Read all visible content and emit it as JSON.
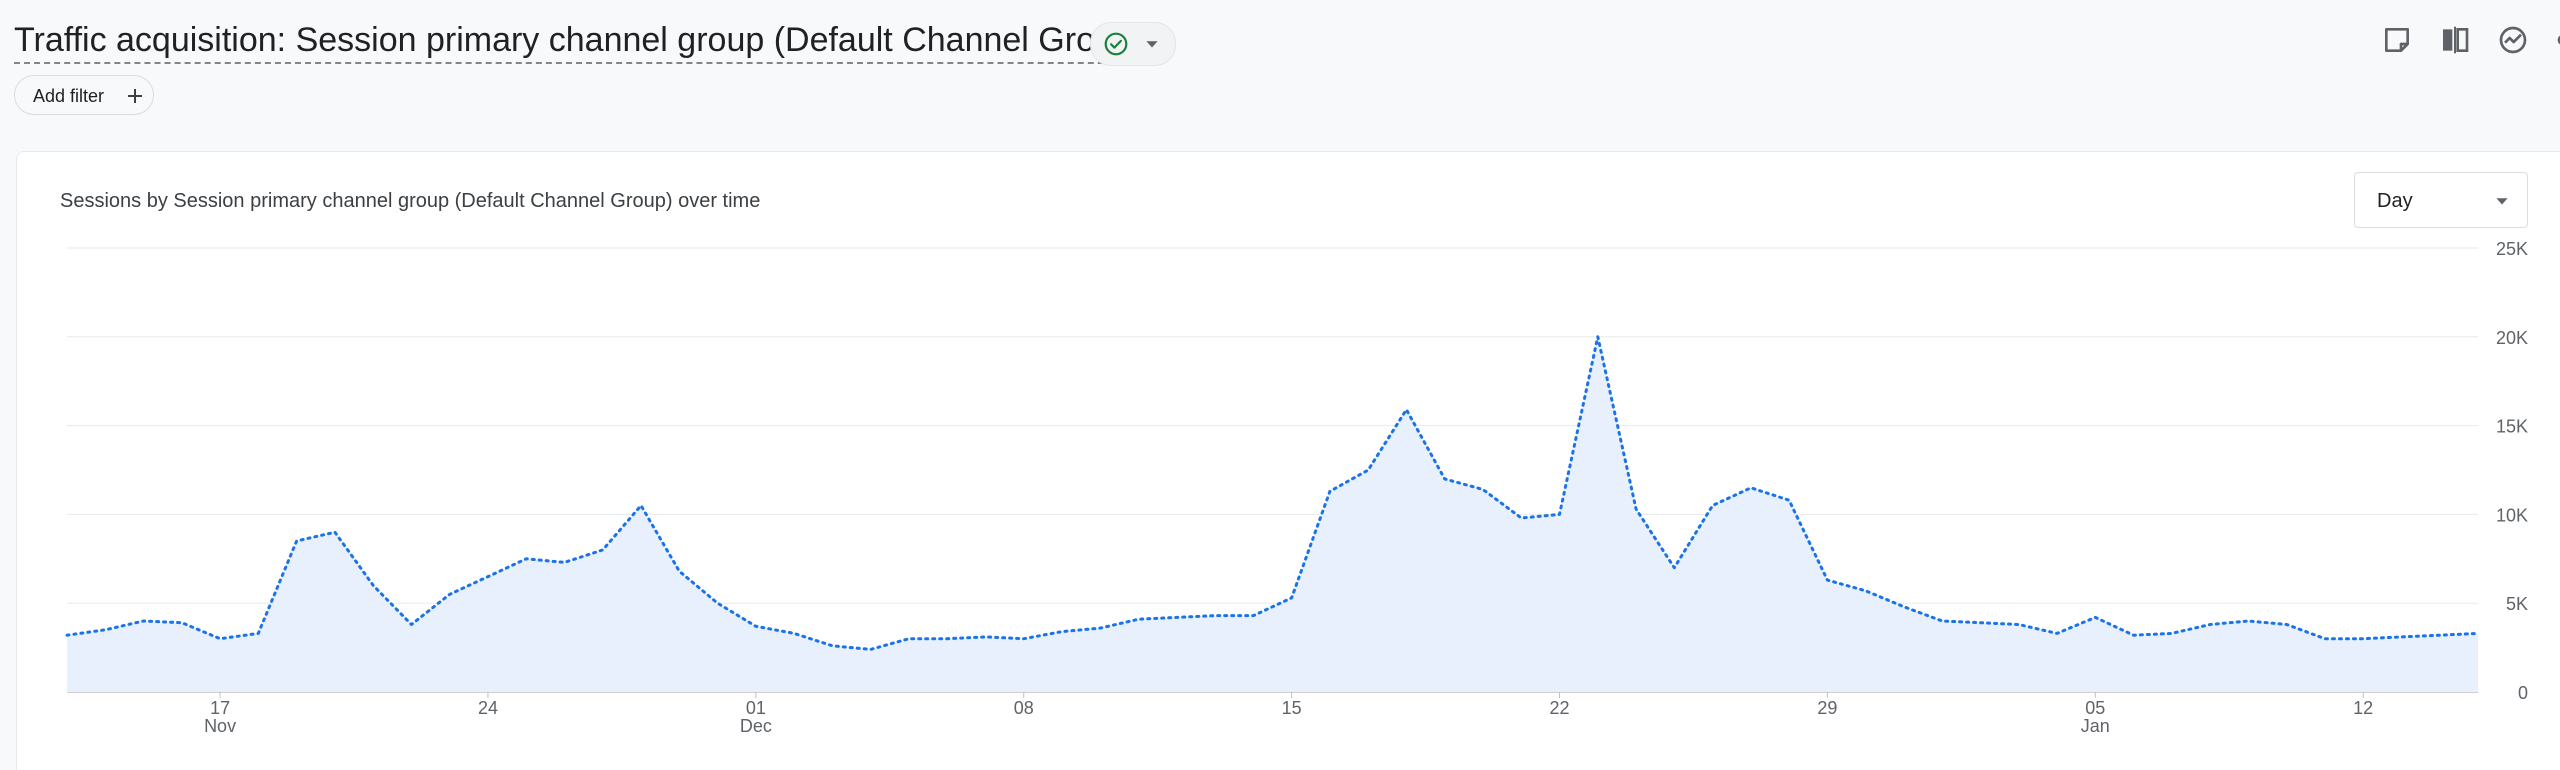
{
  "header": {
    "title": "Traffic acquisition: Session primary channel group (Default Channel Group)",
    "status_icon": "check-circle-icon",
    "status_color": "#188038",
    "toolbar_icons": [
      "note-icon",
      "compare-icon",
      "insights-icon",
      "share-icon",
      "trend-icon"
    ]
  },
  "filter": {
    "add_label": "Add filter"
  },
  "card": {
    "title": "Sessions by Session primary channel group (Default Channel Group) over time",
    "granularity": "Day"
  },
  "chart_data": {
    "type": "area",
    "title": "Sessions by Session primary channel group (Default Channel Group) over time",
    "xlabel": "",
    "ylabel": "",
    "ylim": [
      0,
      25000
    ],
    "y_ticks": [
      0,
      5000,
      10000,
      15000,
      20000,
      25000
    ],
    "y_tick_labels": [
      "0",
      "5K",
      "10K",
      "15K",
      "20K",
      "25K"
    ],
    "x_start": "2023-11-13",
    "x_end": "2024-01-15",
    "x_ticks": [
      {
        "date": "2023-11-17",
        "label": "17",
        "month": "Nov"
      },
      {
        "date": "2023-11-24",
        "label": "24",
        "month": ""
      },
      {
        "date": "2023-12-01",
        "label": "01",
        "month": "Dec"
      },
      {
        "date": "2023-12-08",
        "label": "08",
        "month": ""
      },
      {
        "date": "2023-12-15",
        "label": "15",
        "month": ""
      },
      {
        "date": "2023-12-22",
        "label": "22",
        "month": ""
      },
      {
        "date": "2023-12-29",
        "label": "29",
        "month": ""
      },
      {
        "date": "2024-01-05",
        "label": "05",
        "month": "Jan"
      },
      {
        "date": "2024-01-12",
        "label": "12",
        "month": ""
      }
    ],
    "grid": true,
    "line_color": "#1a73e8",
    "fill_color": "#e8f0fe",
    "series": [
      {
        "points": [
          [
            "2023-11-13",
            3200
          ],
          [
            "2023-11-14",
            3500
          ],
          [
            "2023-11-15",
            4000
          ],
          [
            "2023-11-16",
            3900
          ],
          [
            "2023-11-17",
            3000
          ],
          [
            "2023-11-18",
            3300
          ],
          [
            "2023-11-19",
            8500
          ],
          [
            "2023-11-20",
            9000
          ],
          [
            "2023-11-21",
            6000
          ],
          [
            "2023-11-22",
            3800
          ],
          [
            "2023-11-23",
            5500
          ],
          [
            "2023-11-24",
            6500
          ],
          [
            "2023-11-25",
            7500
          ],
          [
            "2023-11-26",
            7300
          ],
          [
            "2023-11-27",
            8000
          ],
          [
            "2023-11-28",
            10500
          ],
          [
            "2023-11-29",
            6800
          ],
          [
            "2023-11-30",
            5000
          ],
          [
            "2023-12-01",
            3700
          ],
          [
            "2023-12-02",
            3300
          ],
          [
            "2023-12-03",
            2600
          ],
          [
            "2023-12-04",
            2400
          ],
          [
            "2023-12-05",
            3000
          ],
          [
            "2023-12-06",
            3000
          ],
          [
            "2023-12-07",
            3100
          ],
          [
            "2023-12-08",
            3000
          ],
          [
            "2023-12-09",
            3400
          ],
          [
            "2023-12-10",
            3600
          ],
          [
            "2023-12-11",
            4100
          ],
          [
            "2023-12-12",
            4200
          ],
          [
            "2023-12-13",
            4300
          ],
          [
            "2023-12-14",
            4300
          ],
          [
            "2023-12-15",
            5300
          ],
          [
            "2023-12-16",
            11300
          ],
          [
            "2023-12-17",
            12500
          ],
          [
            "2023-12-18",
            15900
          ],
          [
            "2023-12-19",
            12000
          ],
          [
            "2023-12-20",
            11400
          ],
          [
            "2023-12-21",
            9800
          ],
          [
            "2023-12-22",
            10000
          ],
          [
            "2023-12-23",
            20000
          ],
          [
            "2023-12-24",
            10300
          ],
          [
            "2023-12-25",
            7000
          ],
          [
            "2023-12-26",
            10500
          ],
          [
            "2023-12-27",
            11500
          ],
          [
            "2023-12-28",
            10800
          ],
          [
            "2023-12-29",
            6300
          ],
          [
            "2023-12-30",
            5700
          ],
          [
            "2023-12-31",
            4800
          ],
          [
            "2024-01-01",
            4000
          ],
          [
            "2024-01-02",
            3900
          ],
          [
            "2024-01-03",
            3800
          ],
          [
            "2024-01-04",
            3300
          ],
          [
            "2024-01-05",
            4200
          ],
          [
            "2024-01-06",
            3200
          ],
          [
            "2024-01-07",
            3300
          ],
          [
            "2024-01-08",
            3800
          ],
          [
            "2024-01-09",
            4000
          ],
          [
            "2024-01-10",
            3800
          ],
          [
            "2024-01-11",
            3000
          ],
          [
            "2024-01-12",
            3000
          ],
          [
            "2024-01-13",
            3100
          ],
          [
            "2024-01-14",
            3200
          ],
          [
            "2024-01-15",
            3300
          ]
        ]
      }
    ]
  }
}
